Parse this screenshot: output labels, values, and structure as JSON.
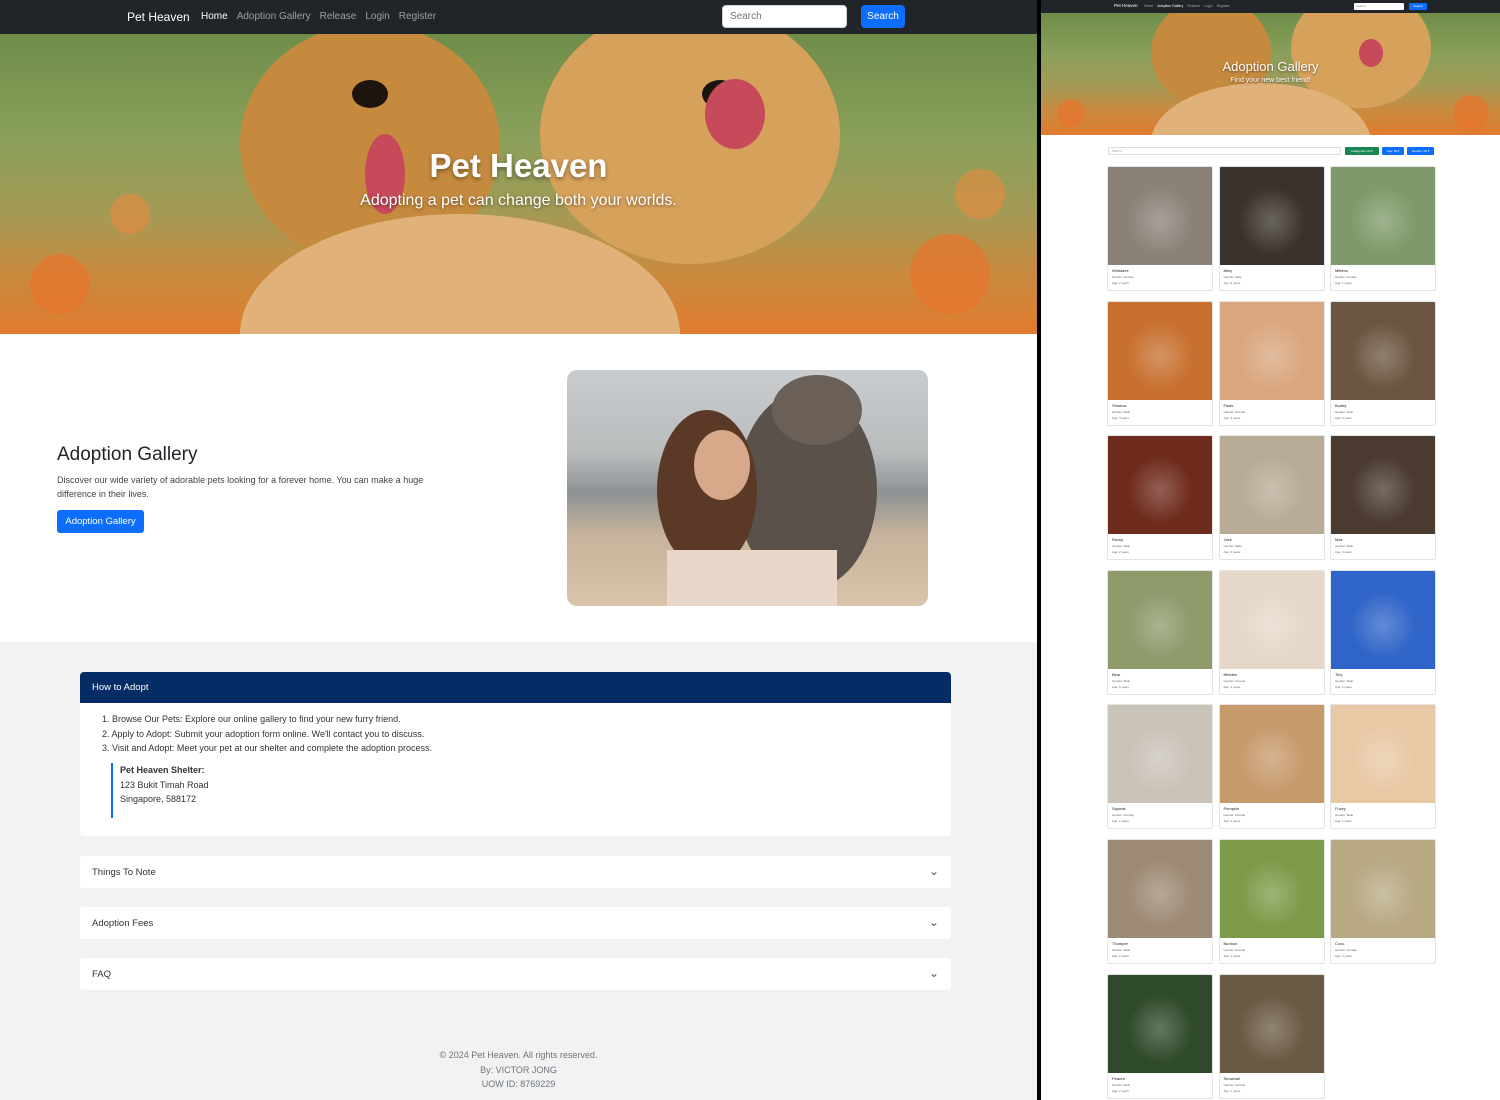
{
  "home": {
    "nav": {
      "brand": "Pet Heaven",
      "links": [
        "Home",
        "Adoption Gallery",
        "Release",
        "Login",
        "Register"
      ],
      "search_placeholder": "Search",
      "search_button": "Search"
    },
    "hero": {
      "title": "Pet Heaven",
      "subtitle": "Adopting a pet can change both your worlds."
    },
    "about": {
      "title": "Adoption Gallery",
      "text": "Discover our wide variety of adorable pets looking for a forever home. You can make a huge difference in their lives.",
      "button": "Adoption Gallery"
    },
    "how_to": {
      "header": "How to Adopt",
      "steps": [
        "1. Browse Our Pets: Explore our online gallery to find your new furry friend.",
        "2. Apply to Adopt: Submit your adoption form online. We'll contact you to discuss.",
        "3. Visit and Adopt: Meet your pet at our shelter and complete the adoption process."
      ],
      "shelter_name": "Pet Heaven Shelter:",
      "shelter_address1": "123 Bukit Timah Road",
      "shelter_address2": "Singapore, 588172"
    },
    "accordions": [
      "Things To Note",
      "Adoption Fees",
      "FAQ"
    ],
    "footer": {
      "copyright": "© 2024 Pet Heaven. All rights reserved.",
      "by": "By: VICTOR JONG",
      "uow": "UOW ID: 8769229"
    }
  },
  "gallery": {
    "nav": {
      "brand": "Pet Heaven",
      "links": [
        "Home",
        "Adoption Gallery",
        "Release",
        "Login",
        "Register"
      ],
      "search_placeholder": "Search",
      "search_button": "Search"
    },
    "hero": {
      "title": "Adoption Gallery",
      "subtitle": "Find your new best friend!"
    },
    "filters": {
      "search_placeholder": "Search...",
      "categories": "Categories: All ▾",
      "age": "Age: All ▾",
      "gender": "Gender: All ▾"
    },
    "pets": [
      {
        "name": "Whiskers",
        "gender": "Gender: Female",
        "age": "Age: 2 years",
        "color": "#8a8278"
      },
      {
        "name": "Alley",
        "gender": "Gender: Male",
        "age": "Age: 3 years",
        "color": "#3a322c"
      },
      {
        "name": "Mittens",
        "gender": "Gender: Female",
        "age": "Age: 1 years",
        "color": "#7e9a6a"
      },
      {
        "name": "Shadow",
        "gender": "Gender: Male",
        "age": "Age: 4 years",
        "color": "#c8702f"
      },
      {
        "name": "Paws",
        "gender": "Gender: Female",
        "age": "Age: 3 years",
        "color": "#d9a77f"
      },
      {
        "name": "Buddy",
        "gender": "Gender: Male",
        "age": "Age: 5 years",
        "color": "#6b5540"
      },
      {
        "name": "Rocky",
        "gender": "Gender: Male",
        "age": "Age: 2 years",
        "color": "#6e2a1c"
      },
      {
        "name": "Jack",
        "gender": "Gender: Male",
        "age": "Age: 3 years",
        "color": "#b8ab95"
      },
      {
        "name": "Max",
        "gender": "Gender: Male",
        "age": "Age: 4 years",
        "color": "#4a3a30"
      },
      {
        "name": "Bear",
        "gender": "Gender: Male",
        "age": "Age: 6 years",
        "color": "#8e9a6c"
      },
      {
        "name": "Nibbles",
        "gender": "Gender: Female",
        "age": "Age: 1 years",
        "color": "#e5d8c8"
      },
      {
        "name": "Tiny",
        "gender": "Gender: Male",
        "age": "Age: 1 years",
        "color": "#2f64c8"
      },
      {
        "name": "Squeak",
        "gender": "Gender: Female",
        "age": "Age: 1 years",
        "color": "#c9c2b8"
      },
      {
        "name": "Pumpkin",
        "gender": "Gender: Female",
        "age": "Age: 1 years",
        "color": "#c79a6c"
      },
      {
        "name": "Fuzzy",
        "gender": "Gender: Male",
        "age": "Age: 1 years",
        "color": "#e8c8a5"
      },
      {
        "name": "Thumper",
        "gender": "Gender: Male",
        "age": "Age: 2 years",
        "color": "#9d8a74"
      },
      {
        "name": "Bunbun",
        "gender": "Gender: Female",
        "age": "Age: 1 years",
        "color": "#7c9a48"
      },
      {
        "name": "Coco",
        "gender": "Gender: Female",
        "age": "Age: 4 years",
        "color": "#b8a984"
      },
      {
        "name": "Peanut",
        "gender": "Gender: Male",
        "age": "Age: 2 years",
        "color": "#2f4a2a"
      },
      {
        "name": "Snowball",
        "gender": "Gender: Female",
        "age": "Age: 1 years",
        "color": "#6a5a44"
      }
    ]
  }
}
